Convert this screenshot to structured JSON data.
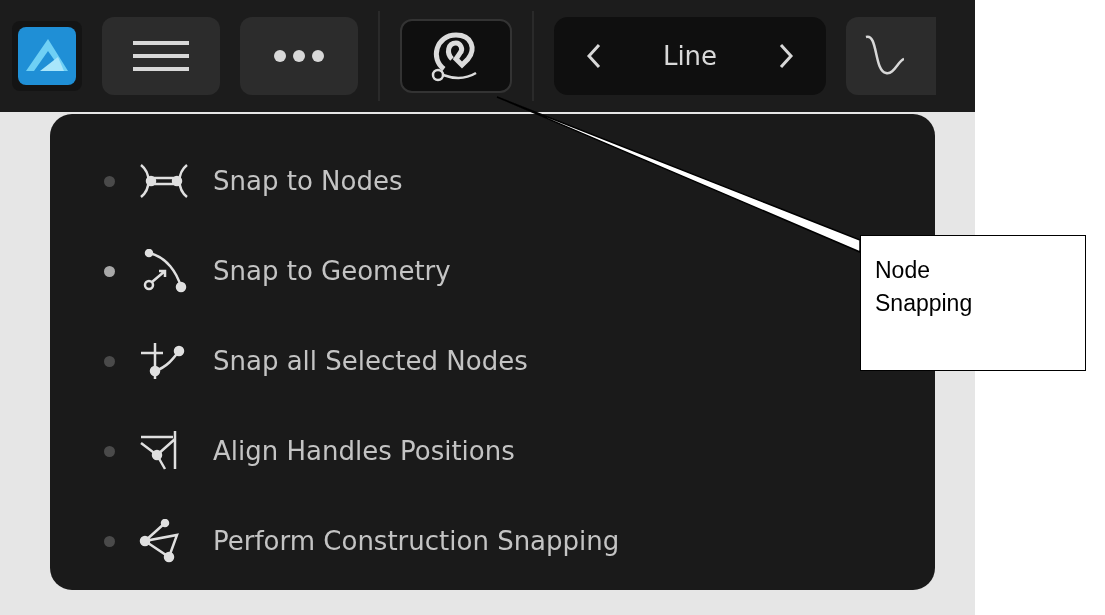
{
  "toolbar": {
    "mode_selector": {
      "label": "Line"
    }
  },
  "snapping_menu": {
    "items": [
      {
        "label": "Snap to Nodes",
        "selected": false,
        "kind": "nodes"
      },
      {
        "label": "Snap to Geometry",
        "selected": true,
        "kind": "geometry"
      },
      {
        "label": "Snap all Selected Nodes",
        "selected": false,
        "kind": "selected"
      },
      {
        "label": "Align Handles Positions",
        "selected": false,
        "kind": "align"
      },
      {
        "label": "Perform Construction Snapping",
        "selected": false,
        "kind": "construction"
      }
    ]
  },
  "callout": {
    "text": "Node Snapping"
  }
}
